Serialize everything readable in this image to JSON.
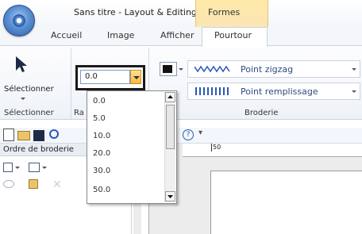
{
  "window": {
    "title": "Sans titre - Layout & Editing",
    "context_tab_group": "Formes"
  },
  "tabs": [
    {
      "label": "Accueil"
    },
    {
      "label": "Image"
    },
    {
      "label": "Afficher"
    },
    {
      "label": "Pourtour",
      "active": true
    }
  ],
  "ribbon": {
    "select_label": "Sélectionner",
    "group_select": "Sélectionner",
    "group_ra": "Ra",
    "group_broderie": "Broderie",
    "width_combo_value": "0.0",
    "stitch_row1": "Point zigzag",
    "stitch_row2": "Point remplissage"
  },
  "dropdown": {
    "options": [
      "0.0",
      "5.0",
      "10.0",
      "20.0",
      "30.0",
      "50.0"
    ]
  },
  "panel": {
    "title": "Ordre de broderie"
  },
  "ruler": {
    "label_50": "50"
  },
  "colors": {
    "accent": "#f6b93c",
    "context_tab": "#fde8a8",
    "highlight_border": "#1a1a1a"
  }
}
